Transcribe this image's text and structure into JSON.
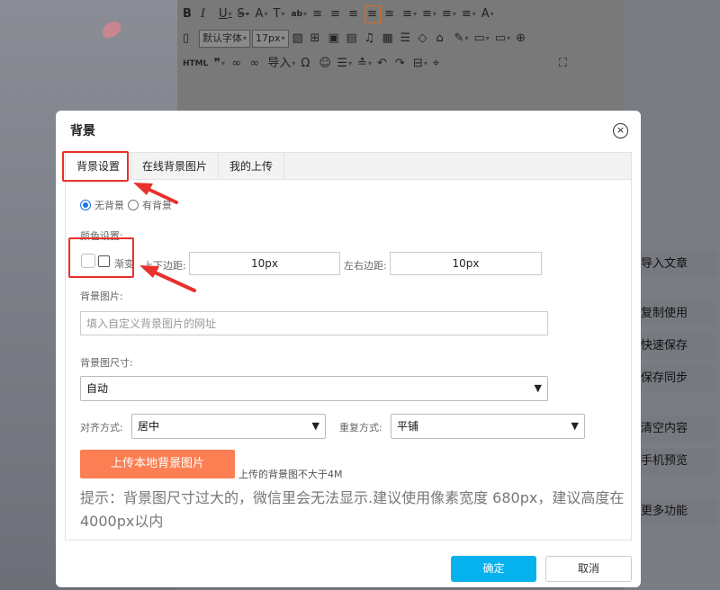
{
  "toolbar": {
    "row1": [
      "B",
      "I",
      "U",
      "S",
      "A",
      "T",
      "ab",
      "≡",
      "≡",
      "≡",
      "≡",
      "≡",
      "≡",
      "≡",
      "≡",
      "≡",
      "A"
    ],
    "row2_font": "默认字体",
    "row2_size": "17px",
    "row3_html": "HTML",
    "row3_import": "导入"
  },
  "side_buttons": [
    "导入文章",
    "复制使用",
    "快速保存",
    "保存同步",
    "清空内容",
    "手机预览",
    "更多功能"
  ],
  "modal": {
    "title": "背景",
    "close": "×",
    "tabs": [
      "背景设置",
      "在线背景图片",
      "我的上传"
    ],
    "no_bg_label": "无背景",
    "has_bg_label": "有背景",
    "color_label": "颜色设置:",
    "gradient_label": "渐变",
    "tb_margin_label": "上下边距:",
    "tb_margin_value": "10px",
    "lr_margin_label": "左右边距:",
    "lr_margin_value": "10px",
    "bg_image_label": "背景图片:",
    "bg_image_placeholder": "填入自定义背景图片的网址",
    "bg_size_label": "背景图尺寸:",
    "bg_size_value": "自动",
    "align_label": "对齐方式:",
    "align_value": "居中",
    "repeat_label": "重复方式:",
    "repeat_value": "平铺",
    "upload_button": "上传本地背景图片",
    "upload_note": "上传的背景图不大于4M",
    "tip": "提示：背景图尺寸过大的，微信里会无法显示.建议使用像素宽度 680px，建议高度在4000px以内",
    "ok_button": "确定",
    "cancel_button": "取消"
  },
  "colors": {
    "accent_blue": "#05b2ee",
    "upload_orange": "#fb7f52",
    "annotation_red": "#e8302d"
  }
}
